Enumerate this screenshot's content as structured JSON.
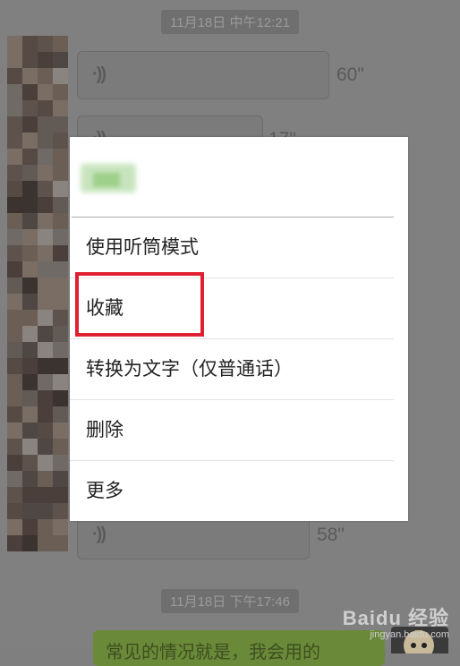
{
  "timestamps": {
    "top": "11月18日 中午12:21",
    "bottom": "11月18日 下午17:46"
  },
  "voice_messages": [
    {
      "duration": "60\""
    },
    {
      "duration": "17\""
    },
    {
      "duration": "58\""
    }
  ],
  "sent_message": {
    "text": "常见的情况就是，我会用的"
  },
  "context_menu": {
    "items": [
      {
        "label": "使用听筒模式"
      },
      {
        "label": "收藏"
      },
      {
        "label": "转换为文字（仅普通话）"
      },
      {
        "label": "删除"
      },
      {
        "label": "更多"
      }
    ],
    "highlighted_index": 1,
    "highlight_color": "#e02030"
  },
  "watermark": {
    "brand": "Baidu 经验",
    "url": "jingyan.baidu.com"
  },
  "icons": {
    "voice": "voice-wave-icon"
  }
}
